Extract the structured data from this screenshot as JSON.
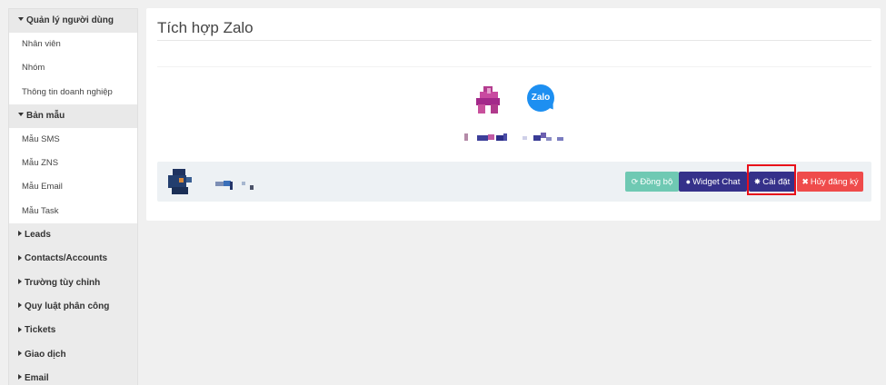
{
  "sidebar": {
    "sections": [
      {
        "label": "Quản lý người dùng",
        "expanded": true,
        "items": [
          "Nhân viên",
          "Nhóm",
          "Thông tin doanh nghiệp"
        ]
      },
      {
        "label": "Bản mẫu",
        "expanded": true,
        "items": [
          "Mẫu SMS",
          "Mẫu ZNS",
          "Mẫu Email",
          "Mẫu Task"
        ]
      }
    ],
    "collapsed": [
      "Leads",
      "Contacts/Accounts",
      "Trường tùy chỉnh",
      "Quy luật phân công",
      "Tickets",
      "Giao dịch",
      "Email"
    ]
  },
  "main": {
    "title": "Tích hợp Zalo",
    "zalo_logo_text": "Zalo",
    "account": {
      "buttons": {
        "sync": "Đồng bộ",
        "widget": "Widget Chat",
        "settings": "Cài đặt",
        "unregister": "Hủy đăng ký"
      }
    }
  },
  "colors": {
    "sync": "#6fc9b3",
    "primary": "#35318a",
    "danger": "#ef4b4b",
    "highlight": "#e8101a",
    "zalo": "#1d8ff1"
  }
}
